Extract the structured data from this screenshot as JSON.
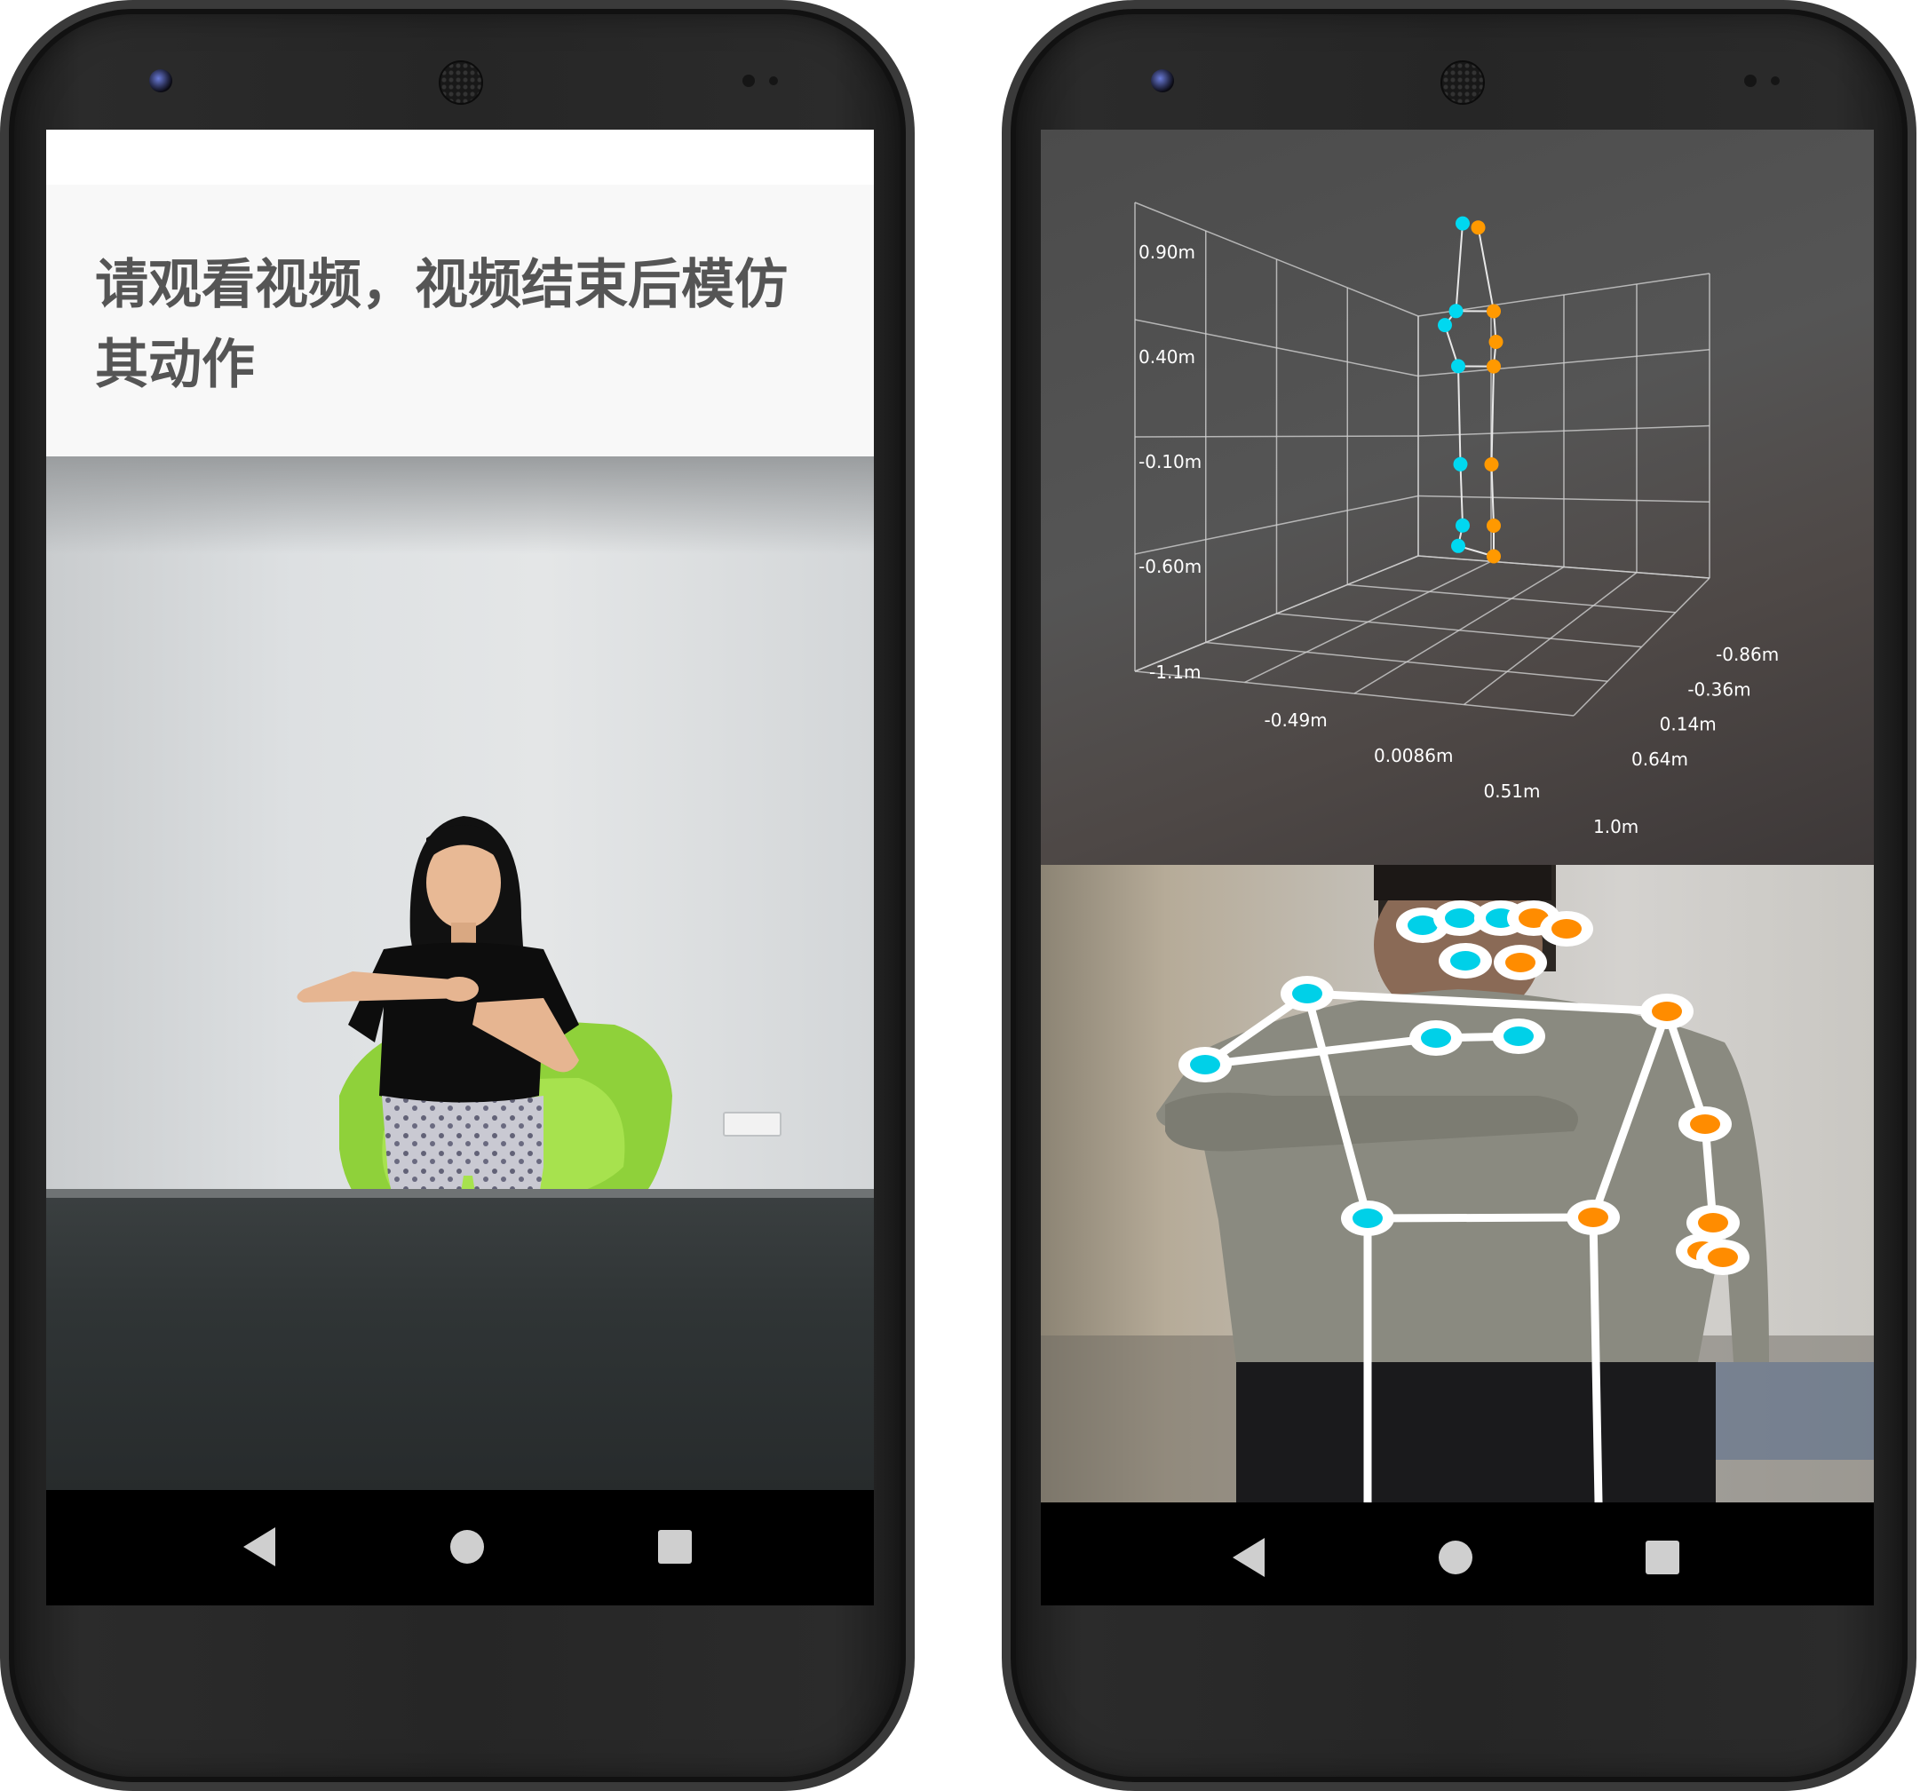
{
  "left_phone": {
    "instruction": "请观看视频，视频结束后模仿其动作",
    "nav": {
      "back": "back-icon",
      "home": "home-icon",
      "recents": "recents-icon"
    }
  },
  "right_phone": {
    "chart_data": {
      "type": "scatter",
      "projection": "3d",
      "z_axis": {
        "ticks": [
          "0.90m",
          "0.40m",
          "-0.10m",
          "-0.60m",
          "-1.1m"
        ]
      },
      "x_axis": {
        "ticks": [
          "-1.1m",
          "-0.49m",
          "0.0086m",
          "0.51m",
          "1.0m"
        ]
      },
      "y_axis": {
        "ticks": [
          "-0.86m",
          "-0.36m",
          "0.14m",
          "0.64m"
        ]
      },
      "grid": true,
      "legend": "none",
      "series": [
        {
          "color": "#00d8f0",
          "points": [
            [
              -0.02,
              0.1,
              0.88
            ],
            [
              -0.05,
              0.08,
              0.45
            ],
            [
              -0.1,
              0.05,
              0.38
            ],
            [
              -0.04,
              0.08,
              0.18
            ],
            [
              -0.03,
              0.08,
              -0.3
            ],
            [
              -0.02,
              0.08,
              -0.6
            ],
            [
              -0.04,
              0.08,
              -0.7
            ]
          ]
        },
        {
          "color": "#ff9900",
          "points": [
            [
              0.05,
              0.1,
              0.86
            ],
            [
              0.12,
              0.1,
              0.45
            ],
            [
              0.13,
              0.1,
              0.3
            ],
            [
              0.12,
              0.1,
              0.18
            ],
            [
              0.11,
              0.1,
              -0.3
            ],
            [
              0.12,
              0.1,
              -0.6
            ],
            [
              0.12,
              0.1,
              -0.75
            ]
          ]
        }
      ]
    },
    "skeleton": {
      "left_color": "#00d0e8",
      "right_color": "#ff8c00",
      "bone_color": "#ffffff"
    },
    "nav": {
      "back": "back-icon",
      "home": "home-icon",
      "recents": "recents-icon"
    }
  }
}
